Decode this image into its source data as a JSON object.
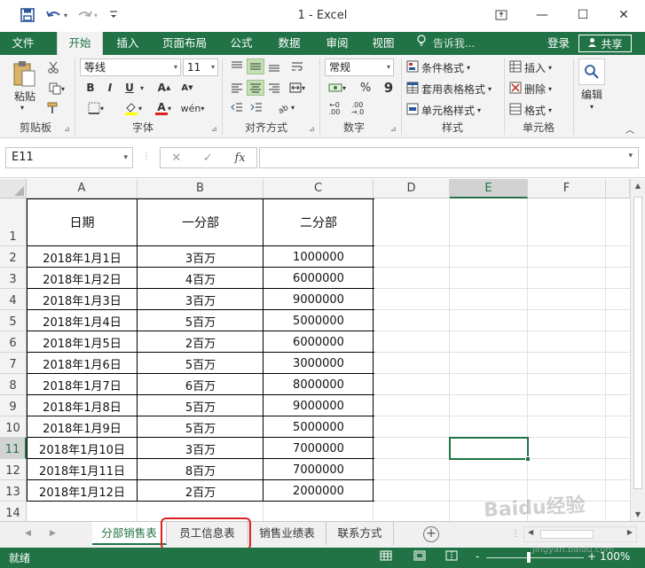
{
  "window": {
    "title": "1 - Excel",
    "qat": {
      "save_icon": "save-icon",
      "undo_icon": "undo-icon",
      "redo_icon": "redo-icon",
      "customize_icon": "customize-icon"
    },
    "controls": {
      "ribbon_display": "⧉",
      "minimize": "—",
      "maximize": "☐",
      "close": "✕"
    }
  },
  "ribbon_tabs": {
    "file": "文件",
    "tabs": [
      "开始",
      "插入",
      "页面布局",
      "公式",
      "数据",
      "审阅",
      "视图"
    ],
    "tellme": "告诉我...",
    "login": "登录",
    "share": "共享"
  },
  "ribbon": {
    "clipboard": {
      "paste": "粘贴",
      "label": "剪贴板"
    },
    "font": {
      "name": "等线",
      "size": "11",
      "bold": "B",
      "italic": "I",
      "underline": "U",
      "grow": "A",
      "shrink": "A",
      "color": "A",
      "label": "字体"
    },
    "alignment": {
      "label": "对齐方式"
    },
    "number": {
      "format": "常规",
      "percent": "%",
      "comma": "9",
      "label": "数字"
    },
    "styles": {
      "conditional": "条件格式",
      "table": "套用表格格式",
      "cell": "单元格样式",
      "label": "样式"
    },
    "cells": {
      "insert": "插入",
      "delete": "删除",
      "format": "格式",
      "label": "单元格"
    },
    "editing": {
      "label": "编辑"
    }
  },
  "formula_bar": {
    "name_box": "E11",
    "cancel": "✕",
    "enter": "✓",
    "fx": "fx",
    "value": ""
  },
  "sheet": {
    "columns": [
      "A",
      "B",
      "C",
      "D",
      "E",
      "F"
    ],
    "selected_column": "E",
    "rows": [
      "1",
      "2",
      "3",
      "4",
      "5",
      "6",
      "7",
      "8",
      "9",
      "10",
      "11",
      "12",
      "13",
      "14"
    ],
    "selected_row": "11",
    "headers": [
      "日期",
      "一分部",
      "二分部"
    ],
    "data": [
      [
        "2018年1月1日",
        "3百万",
        "1000000"
      ],
      [
        "2018年1月2日",
        "4百万",
        "6000000"
      ],
      [
        "2018年1月3日",
        "3百万",
        "9000000"
      ],
      [
        "2018年1月4日",
        "5百万",
        "5000000"
      ],
      [
        "2018年1月5日",
        "2百万",
        "6000000"
      ],
      [
        "2018年1月6日",
        "5百万",
        "3000000"
      ],
      [
        "2018年1月7日",
        "6百万",
        "8000000"
      ],
      [
        "2018年1月8日",
        "5百万",
        "9000000"
      ],
      [
        "2018年1月9日",
        "5百万",
        "5000000"
      ],
      [
        "2018年1月10日",
        "3百万",
        "7000000"
      ],
      [
        "2018年1月11日",
        "8百万",
        "7000000"
      ],
      [
        "2018年1月12日",
        "2百万",
        "2000000"
      ]
    ]
  },
  "sheet_tabs": {
    "tabs": [
      "分部销售表",
      "员工信息表",
      "销售业绩表",
      "联系方式"
    ],
    "active": "分部销售表",
    "add": "+"
  },
  "status_bar": {
    "ready": "就绪",
    "zoom": "100%",
    "zoom_out": "-",
    "zoom_in": "+"
  },
  "watermark": {
    "text": "Baidu经验",
    "url": "jingyan.baidu.com"
  },
  "colors": {
    "accent": "#217346",
    "highlight": "#e02020"
  }
}
